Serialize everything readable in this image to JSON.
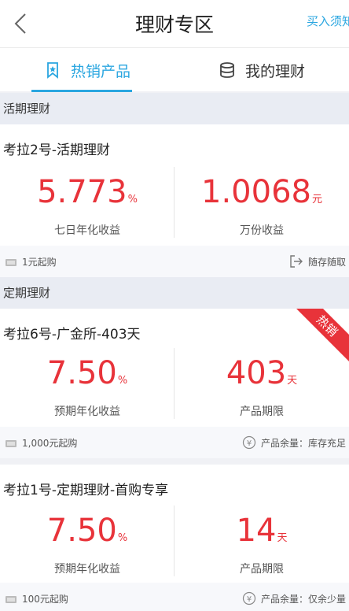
{
  "nav": {
    "title": "理财专区",
    "right_link": "买入须知"
  },
  "tabs": [
    {
      "label": "热销产品",
      "icon": "bookmark-icon",
      "active": true
    },
    {
      "label": "我的理财",
      "icon": "database-icon",
      "active": false
    }
  ],
  "colors": {
    "accent": "#2aa6e0",
    "value_red": "#e8333a",
    "section_bg": "#e9ecf3"
  },
  "sections": {
    "current": "活期理财",
    "fixed": "定期理财"
  },
  "products": [
    {
      "title": "考拉2号-活期理财",
      "left_value": "5.773",
      "left_unit": "%",
      "left_label": "七日年化收益",
      "right_value": "1.0068",
      "right_unit": "元",
      "right_label": "万份收益",
      "foot_left": "1元起购",
      "foot_right": "随存随取",
      "badge": ""
    },
    {
      "title": "考拉6号-广金所-403天",
      "left_value": "7.50",
      "left_unit": "%",
      "left_label": "预期年化收益",
      "right_value": "403",
      "right_unit": "天",
      "right_label": "产品期限",
      "foot_left": "1,000元起购",
      "foot_right": "产品余量：库存充足",
      "badge": "热销"
    },
    {
      "title": "考拉1号-定期理财-首购专享",
      "left_value": "7.50",
      "left_unit": "%",
      "left_label": "预期年化收益",
      "right_value": "14",
      "right_unit": "天",
      "right_label": "产品期限",
      "foot_left": "100元起购",
      "foot_right": "产品余量：仅余少量",
      "badge": ""
    }
  ]
}
